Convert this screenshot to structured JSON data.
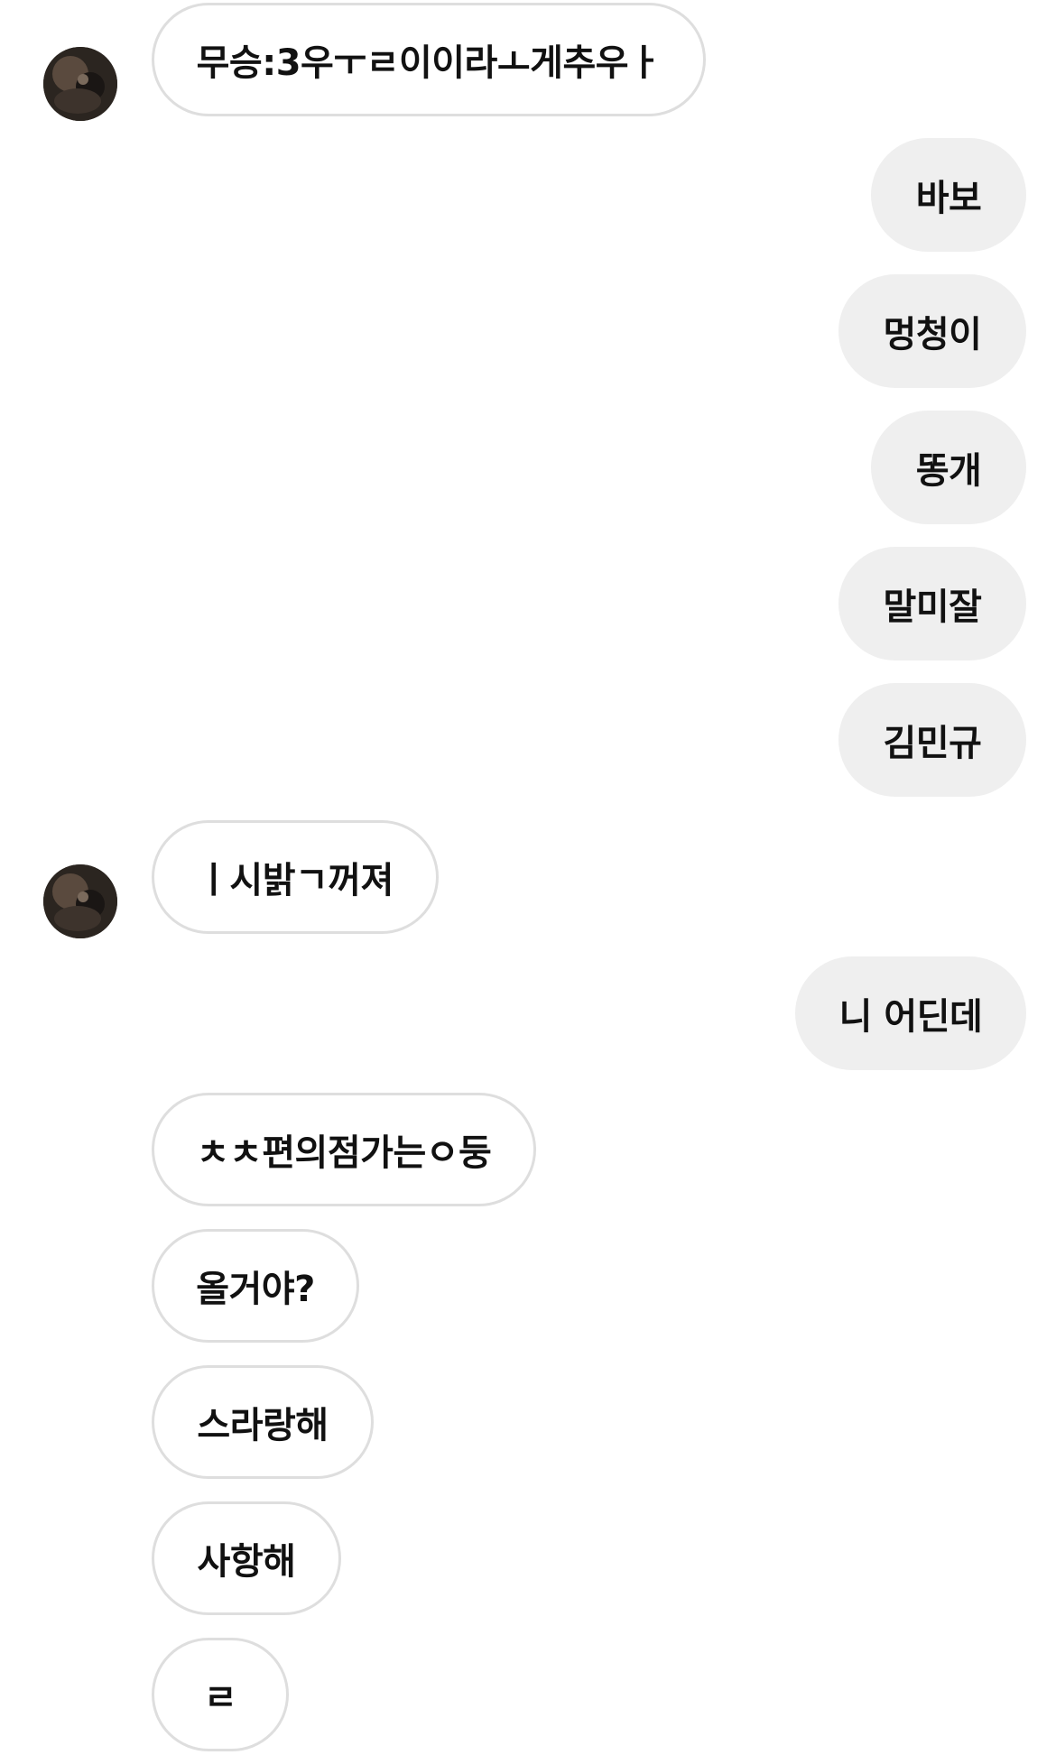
{
  "conversation": {
    "messages": [
      {
        "sender": "them",
        "text": "무승:3우ㅜㄹ이이라ㅗ게추우ㅏ",
        "avatar": true
      },
      {
        "sender": "me",
        "text": "바보"
      },
      {
        "sender": "me",
        "text": "멍청이"
      },
      {
        "sender": "me",
        "text": "똥개"
      },
      {
        "sender": "me",
        "text": "말미잘"
      },
      {
        "sender": "me",
        "text": "김민규"
      },
      {
        "sender": "them",
        "text": "ㅣ시밝ㄱ꺼져",
        "avatar": true
      },
      {
        "sender": "me",
        "text": "니 어딘데"
      },
      {
        "sender": "them",
        "text": "ㅊㅊ편의점가는ㅇ둥"
      },
      {
        "sender": "them",
        "text": "올거야?"
      },
      {
        "sender": "them",
        "text": "스라랑해"
      },
      {
        "sender": "them",
        "text": "사항해"
      },
      {
        "sender": "them",
        "text": "ㄹ"
      }
    ]
  },
  "colors": {
    "incoming_bubble_border": "#dedede",
    "incoming_bubble_bg": "#ffffff",
    "outgoing_bubble_bg": "#efefef",
    "text": "#111111",
    "background": "#ffffff"
  },
  "icons": {
    "avatar": "profile-photo"
  }
}
